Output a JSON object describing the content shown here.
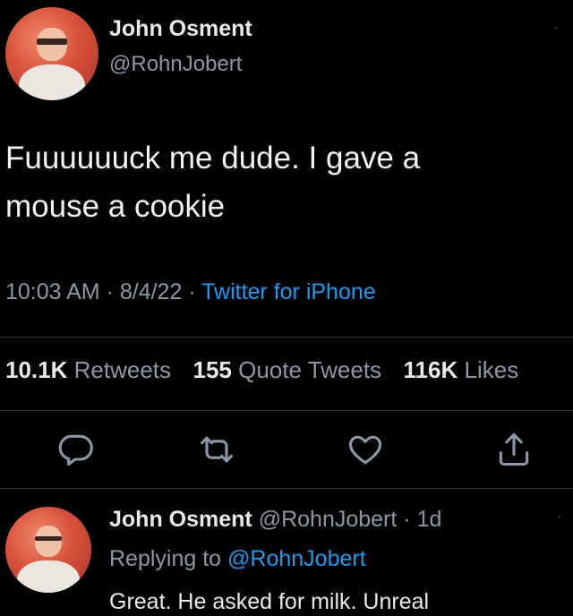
{
  "tweet": {
    "author_name": "John Osment",
    "author_handle": "@RohnJobert",
    "more_glyph": "·",
    "text_line1": "Fuuuuuuck me dude. I gave a",
    "text_line2": "mouse a cookie",
    "time": "10:03 AM",
    "sep1": " · ",
    "date": "8/4/22",
    "sep2": " · ",
    "source": "Twitter for iPhone",
    "stats": {
      "retweets_count": "10.1K",
      "retweets_label": "Retweets",
      "quotes_count": "155",
      "quotes_label": "Quote Tweets",
      "likes_count": "116K",
      "likes_label": "Likes"
    },
    "actions": {
      "reply_icon": "reply-icon",
      "retweet_icon": "retweet-icon",
      "like_icon": "heart-icon",
      "share_icon": "share-icon"
    }
  },
  "reply": {
    "author_name": "John Osment",
    "author_handle": "@RohnJobert",
    "sep": " · ",
    "age": "1d",
    "more_glyph": "·",
    "replying_prefix": "Replying to ",
    "replying_to": "@RohnJobert",
    "text": "Great. He asked for milk. Unreal"
  },
  "colors": {
    "background": "#000000",
    "primary_text": "#e7e9ea",
    "secondary_text": "#8b98a5",
    "link": "#1d9bf0",
    "divider": "#2f3336"
  }
}
